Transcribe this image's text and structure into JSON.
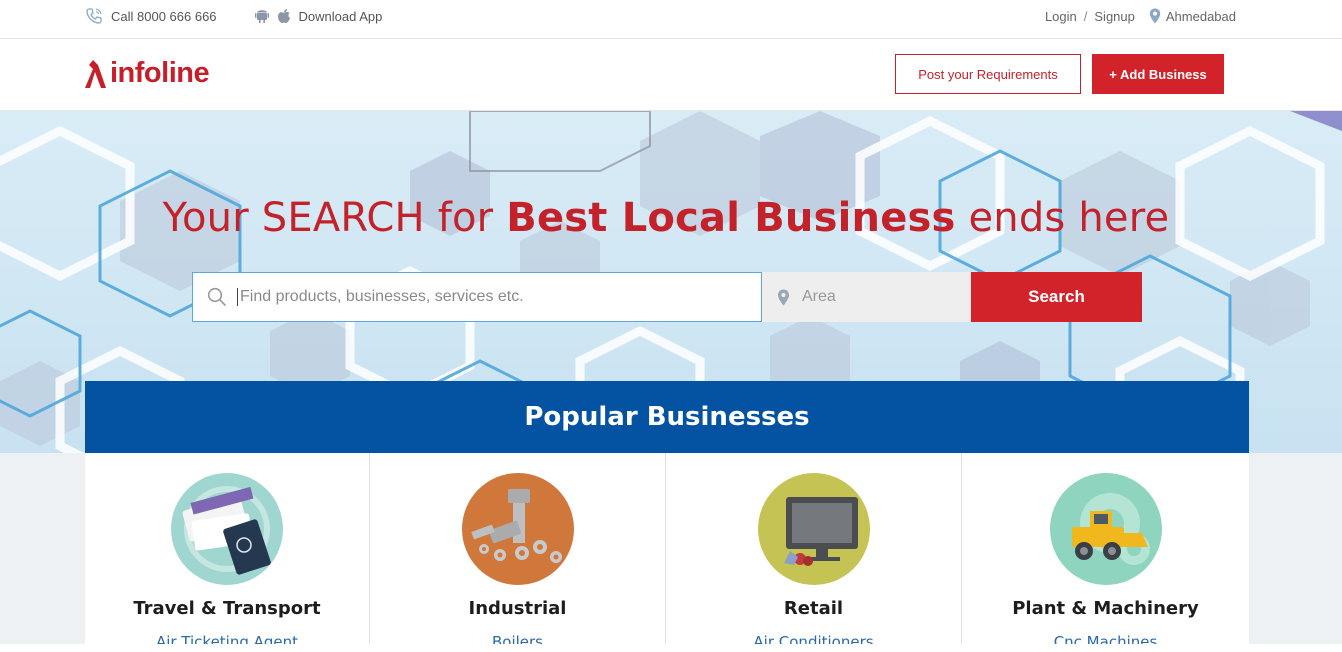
{
  "topbar": {
    "call_label": "Call 8000 666 666",
    "download_label": "Download App",
    "login_label": "Login",
    "separator": "/",
    "signup_label": "Signup",
    "city_label": "Ahmedabad"
  },
  "header": {
    "logo_text": "infoline",
    "post_button_label": "Post your Requirements",
    "add_button_label": "+ Add Business"
  },
  "hero": {
    "headline_part1": "Your SEARCH for ",
    "headline_bold": "Best Local Business",
    "headline_part2": " ends here",
    "search_placeholder": "Find products, businesses, services etc.",
    "area_placeholder": "Area",
    "search_button_label": "Search"
  },
  "popular": {
    "title": "Popular Businesses",
    "categories": [
      {
        "name": "Travel & Transport",
        "first_item": "Air Ticketing Agent",
        "icon": "travel-icon",
        "bg": "#9fd6cf"
      },
      {
        "name": "Industrial",
        "first_item": "Boilers",
        "icon": "industrial-icon",
        "bg": "#d0773c"
      },
      {
        "name": "Retail",
        "first_item": "Air Conditioners",
        "icon": "retail-icon",
        "bg": "#c6c355"
      },
      {
        "name": "Plant & Machinery",
        "first_item": "Cnc Machines",
        "icon": "machinery-icon",
        "bg": "#8fd4be"
      }
    ]
  },
  "colors": {
    "brand_red": "#d2232a",
    "brand_blue": "#0453a3",
    "link_blue": "#2a6aa8"
  }
}
